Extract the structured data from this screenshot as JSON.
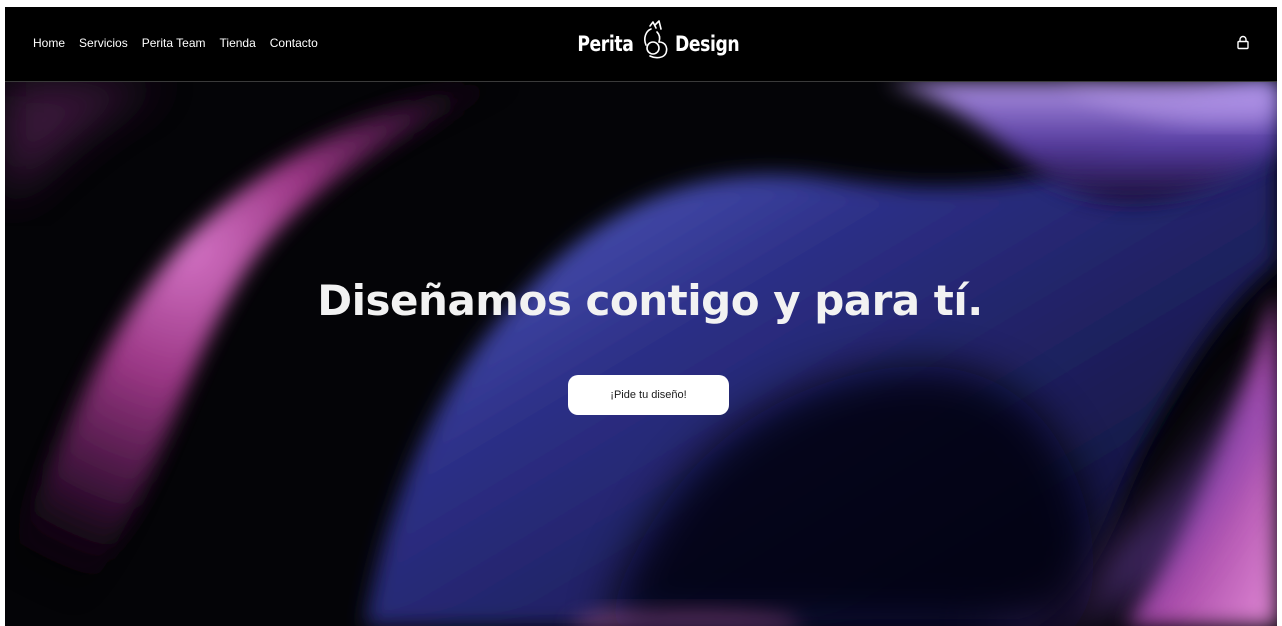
{
  "header": {
    "nav": [
      {
        "label": "Home"
      },
      {
        "label": "Servicios"
      },
      {
        "label": "Perita Team"
      },
      {
        "label": "Tienda"
      },
      {
        "label": "Contacto"
      }
    ],
    "logo": {
      "left_word": "Perita",
      "right_word": "Design",
      "mark_icon": "ok-hand-icon"
    },
    "cart_icon": "shopping-bag-icon"
  },
  "hero": {
    "headline": "Diseñamos contigo y para tí.",
    "cta_label": "¡Pide tu diseño!"
  },
  "colors": {
    "background": "#000000",
    "text": "#ffffff",
    "accent_pink": "#c24a9c",
    "accent_blue": "#4b4fb8",
    "accent_violet": "#8a6ad6",
    "button_bg": "#ffffff"
  }
}
